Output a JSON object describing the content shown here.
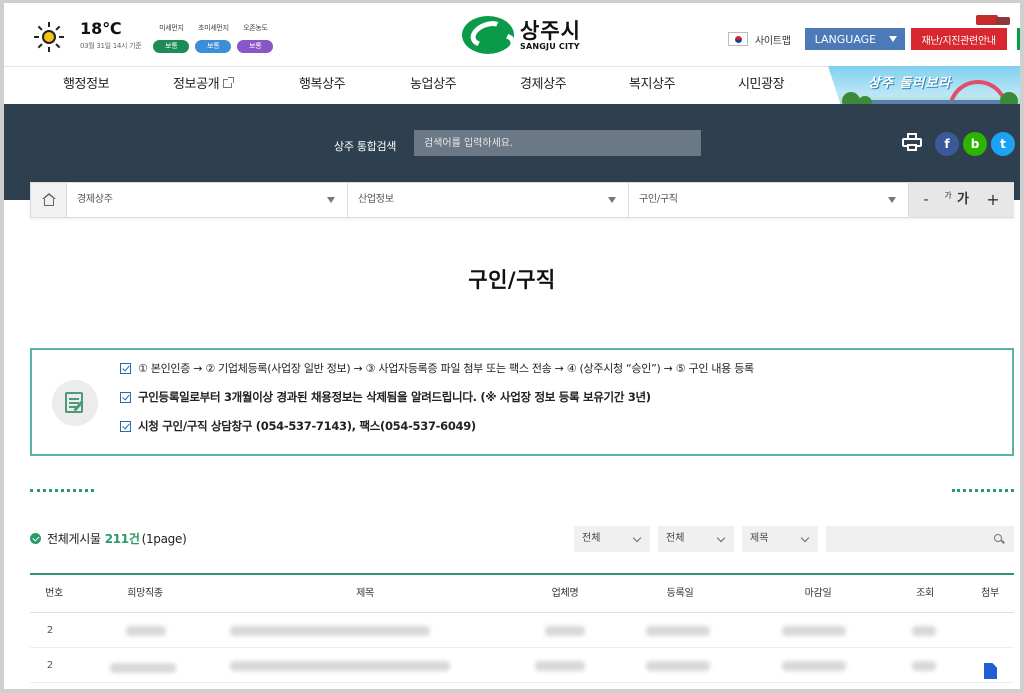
{
  "weather": {
    "temperature": "18℃",
    "date": "03월 31일 14시 기준",
    "air": [
      {
        "label": "미세먼지",
        "status": "보통",
        "color": "#1e8a55"
      },
      {
        "label": "초미세먼지",
        "status": "보통",
        "color": "#3a8fd6"
      },
      {
        "label": "오존농도",
        "status": "보통",
        "color": "#8a55c6"
      }
    ]
  },
  "logo": {
    "korean": "상주시",
    "english": "SANGJU CITY"
  },
  "topbar": {
    "sitemap": "사이트맵",
    "language": "LANGUAGE",
    "disaster": "재난/지진관련안내"
  },
  "nav": {
    "items": [
      "행정정보",
      "정보공개",
      "행복상주",
      "농업상주",
      "경제상주",
      "복지상주",
      "시민광장"
    ],
    "banner": "상주 둘러보라"
  },
  "search": {
    "label": "상주 통합검색",
    "placeholder": "검색어를 입력하세요."
  },
  "sns": {
    "facebook": "f",
    "blog": "b",
    "twitter": "t",
    "facebook_color": "#3b5998",
    "blog_color": "#2db400",
    "twitter_color": "#1da1f2"
  },
  "breadcrumb": {
    "items": [
      "경제상주",
      "산업정보",
      "구인/구직"
    ],
    "font_minus": "-",
    "font_small": "가",
    "font_large": "가",
    "font_plus": "+"
  },
  "page": {
    "title": "구인/구직"
  },
  "notice": {
    "lines": [
      "① 본인인증 → ② 기업체등록(사업장 일반 정보) → ③ 사업자등록증 파일 첨부 또는 팩스 전송 → ④ (상주시청 “승인”) → ⑤ 구인 내용 등록",
      "구인등록일로부터 3개월이상 경과된 채용정보는 삭제됨을 알려드립니다. (※ 사업장 정보 등록 보유기간 3년)",
      "시청 구인/구직 상담창구 (054-537-7143), 팩스(054-537-6049)"
    ]
  },
  "list": {
    "count_prefix": "전체게시물",
    "count": "211건",
    "page_info": "(1page)",
    "filters": [
      "전체",
      "전체",
      "제목"
    ],
    "columns": [
      "번호",
      "희망직종",
      "제목",
      "업체명",
      "등록일",
      "마감일",
      "조회",
      "첨부"
    ],
    "rows": [
      {
        "no": "2"
      },
      {
        "no": "2"
      }
    ]
  },
  "colors": {
    "accent": "#2a9a6a",
    "nav_dark": "#2e4050",
    "language": "#4c79b8",
    "disaster": "#d7272f"
  }
}
